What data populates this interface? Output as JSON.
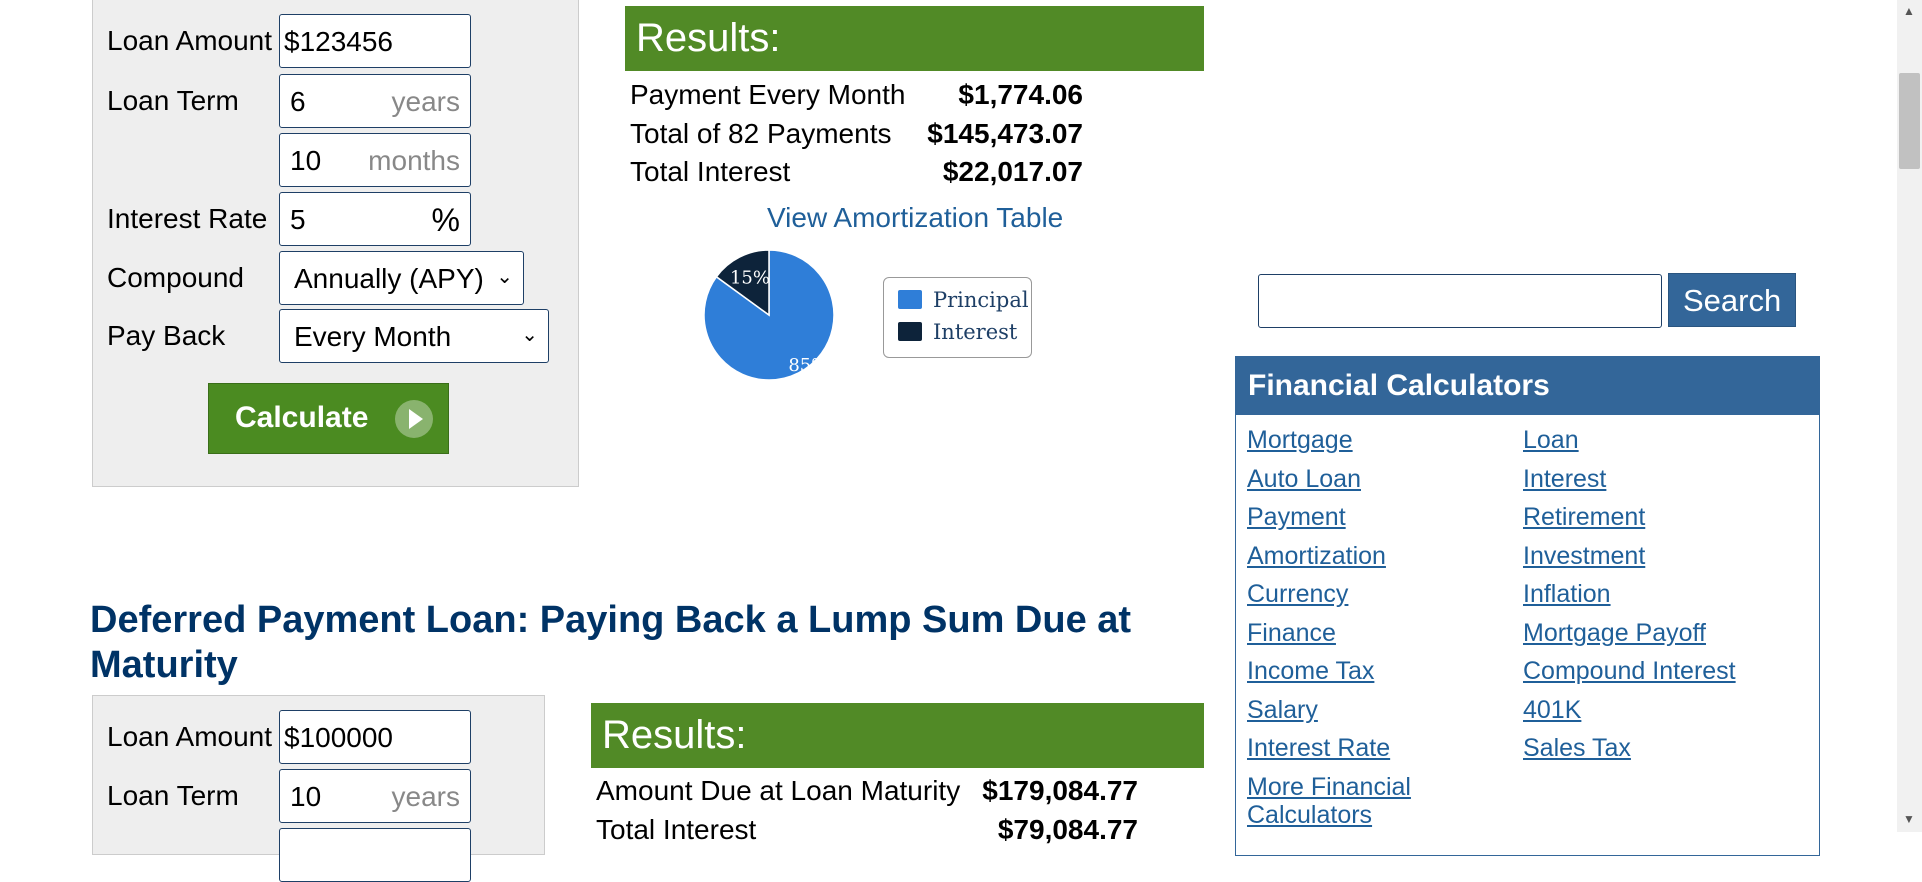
{
  "calc1": {
    "loan_amount_label": "Loan Amount",
    "loan_amount_value": "$123456",
    "loan_term_label": "Loan Term",
    "loan_term_years": "6",
    "years_unit": "years",
    "loan_term_months": "10",
    "months_unit": "months",
    "interest_rate_label": "Interest Rate",
    "interest_rate_value": "5",
    "percent_unit": "%",
    "compound_label": "Compound",
    "compound_value": "Annually (APY)",
    "payback_label": "Pay Back",
    "payback_value": "Every Month",
    "calculate_label": "Calculate"
  },
  "results1": {
    "heading": "Results:",
    "rows": [
      {
        "label": "Payment Every Month",
        "value": "$1,774.06"
      },
      {
        "label": "Total of 82 Payments",
        "value": "$145,473.07"
      },
      {
        "label": "Total Interest",
        "value": "$22,017.07"
      }
    ],
    "amortization_link": "View Amortization Table"
  },
  "chart_data": {
    "type": "pie",
    "categories": [
      "Principal",
      "Interest"
    ],
    "values": [
      85,
      15
    ],
    "labels": [
      "85%",
      "15%"
    ],
    "colors": [
      "#2f7ed8",
      "#0d233a"
    ],
    "legend_position": "right"
  },
  "section2": {
    "heading": "Deferred Payment Loan: Paying Back a Lump Sum Due at Maturity",
    "loan_amount_label": "Loan Amount",
    "loan_amount_value": "$100000",
    "loan_term_label": "Loan Term",
    "loan_term_years": "10",
    "years_unit": "years"
  },
  "results2": {
    "heading": "Results:",
    "rows": [
      {
        "label": "Amount Due at Loan Maturity",
        "value": "$179,084.77"
      },
      {
        "label": "Total Interest",
        "value": "$79,084.77"
      }
    ]
  },
  "sidebar": {
    "search_button": "Search",
    "search_value": "",
    "box_title": "Financial Calculators",
    "links_left": [
      "Mortgage",
      "Auto Loan",
      "Payment",
      "Amortization",
      "Currency",
      "Finance",
      "Income Tax",
      "Salary",
      "Interest Rate",
      "More Financial Calculators"
    ],
    "links_right": [
      "Loan",
      "Interest",
      "Retirement",
      "Investment",
      "Inflation",
      "Mortgage Payoff",
      "Compound Interest",
      "401K",
      "Sales Tax"
    ]
  },
  "colors": {
    "results_green": "#518a26",
    "nav_blue": "#336699",
    "heading_navy": "#003366",
    "link_blue": "#1f5f99"
  },
  "icons": [
    "calculate-arrow-icon",
    "chevron-down-icon",
    "scroll-up-icon",
    "scroll-down-icon"
  ]
}
